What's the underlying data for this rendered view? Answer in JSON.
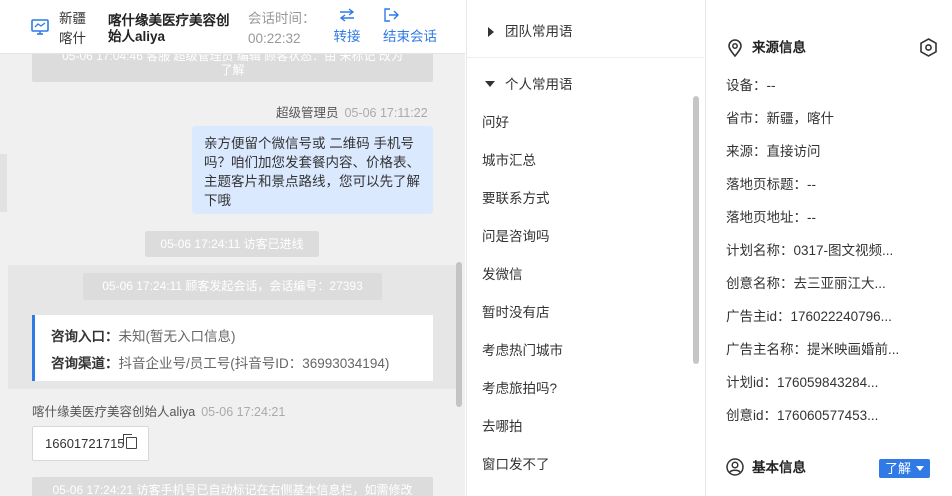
{
  "header": {
    "location_line1": "新疆",
    "location_line2": "喀什",
    "customer_name_line1": "喀什缘美医疗美容创",
    "customer_name_line2": "始人aliya",
    "session_time_label": "会话时间：",
    "session_time_value": "00:22:32",
    "transfer_label": "转接",
    "end_session_label": "结束会话"
  },
  "messages": {
    "top_sys_line1": "05-06 17:04:46 客服 超级管理员 编辑 顾客状态：由 未标记 改为",
    "top_sys_line2": "了解",
    "agent_sender": "超级管理员",
    "agent_time": "05-06 17:11:22",
    "agent_text": "亲方便留个微信号或 二维码 手机号吗？咱们加您发套餐内容、价格表、主题客片和景点路线，您可以先了解下哦",
    "visitor_entered": "05-06 17:24:11 访客已进线",
    "session_started": "05-06 17:24:11 顾客发起会话，会话编号：27393",
    "entry_label": "咨询入口：",
    "entry_value": "未知(暂无入口信息)",
    "channel_label": "咨询渠道：",
    "channel_value": "抖音企业号/员工号(抖音号ID：36993034194)",
    "customer_sender": "喀什缘美医疗美容创始人aliya",
    "customer_time": "05-06 17:24:21",
    "phone_number": "16601721715",
    "bottom_sys": "05-06 17:24:21 访客手机号已自动标记在右侧基本信息栏，如需修改"
  },
  "phrases": {
    "team_group": "团队常用语",
    "personal_group": "个人常用语",
    "items": [
      "问好",
      "城市汇总",
      "要联系方式",
      "问是咨询吗",
      "发微信",
      "暂时没有店",
      "考虑热门城市",
      "考虑旅拍吗?",
      "去哪拍",
      "窗口发不了"
    ]
  },
  "source": {
    "title": "来源信息",
    "rows": [
      "设备：--",
      "省市：新疆，喀什",
      "来源：直接访问",
      "落地页标题：--",
      "落地页地址：--",
      "计划名称：0317-图文视频...",
      "创意名称：去三亚丽江大...",
      "广告主id：176022240796...",
      "广告主名称：提米映画婚前...",
      "计划id：176059843284...",
      "创意id：176060577453..."
    ],
    "basic_title": "基本信息",
    "status_tag": "了解"
  },
  "colors": {
    "accent": "#2f7ae5",
    "bubble": "#dbe9ff",
    "system_pill": "#dcdcdc"
  }
}
